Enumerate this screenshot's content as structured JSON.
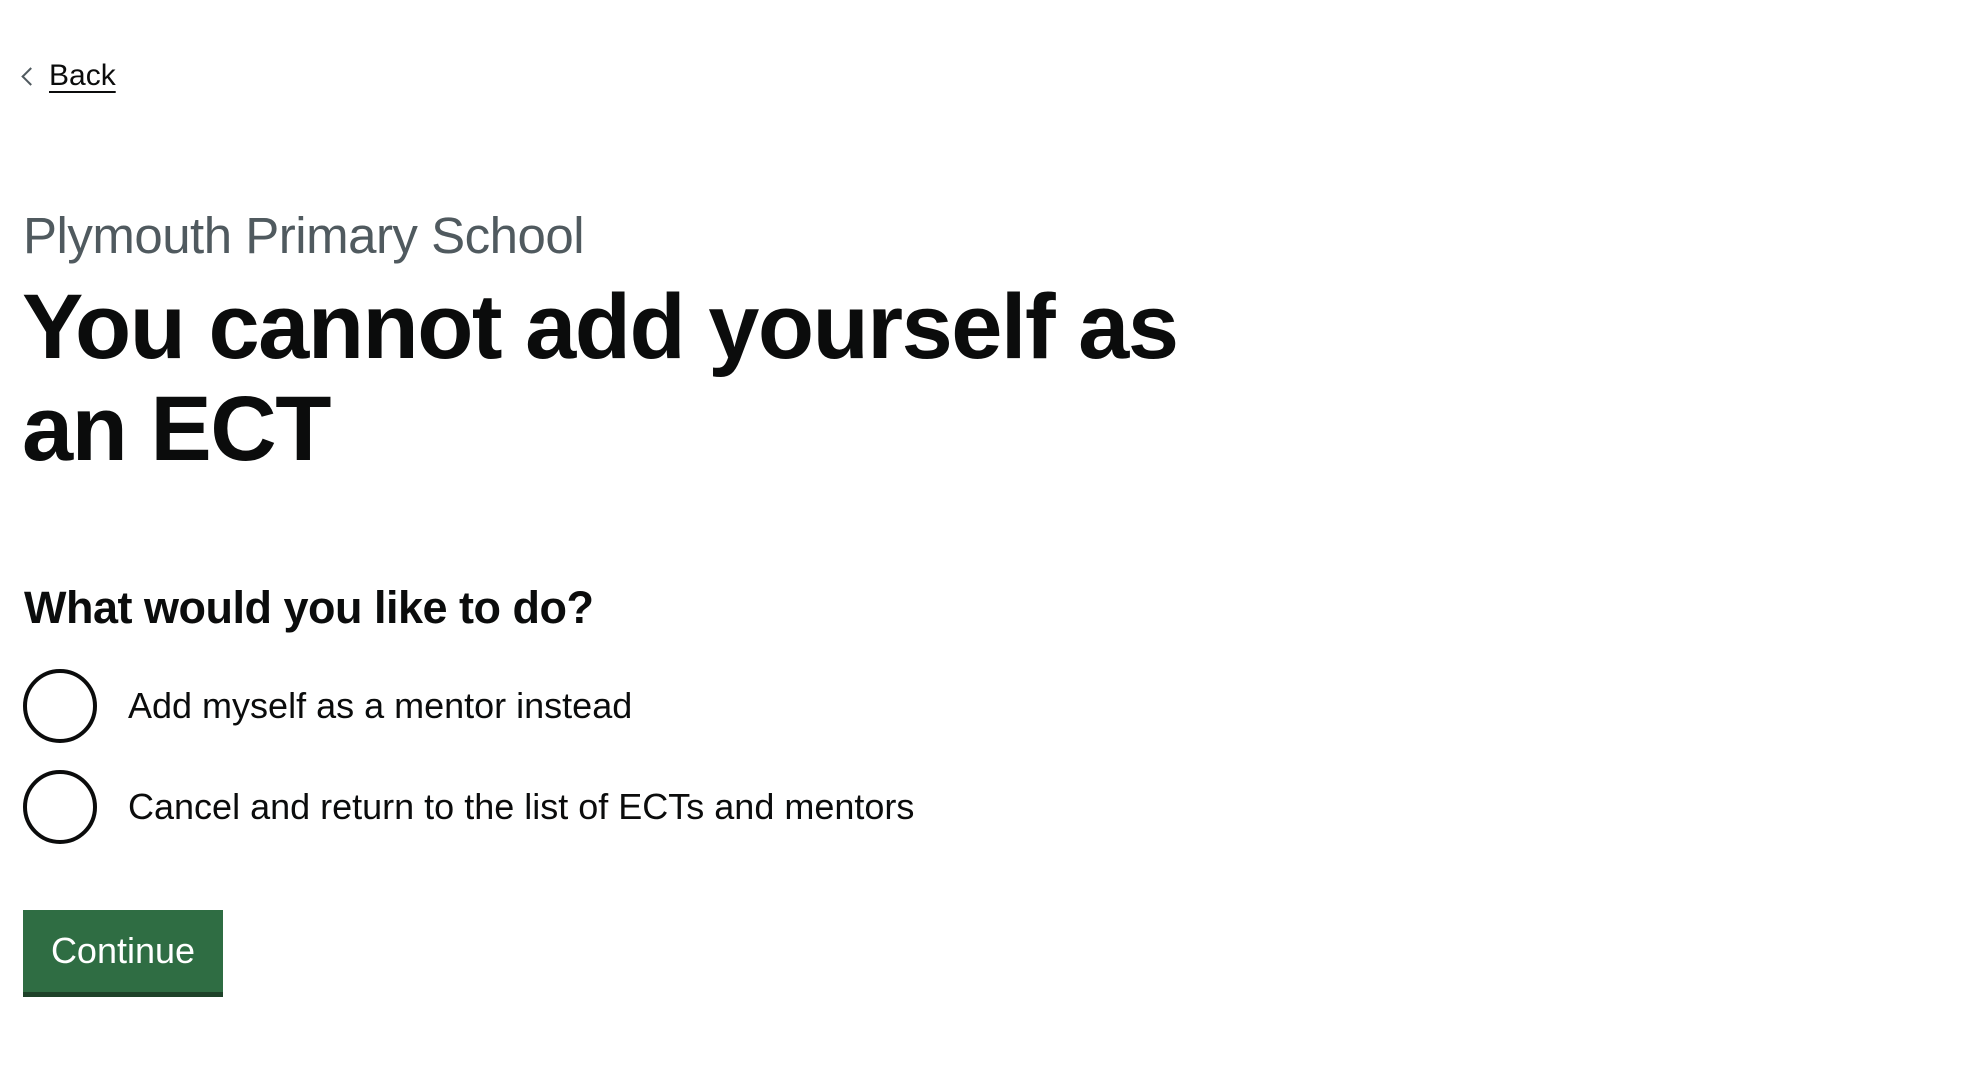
{
  "navigation": {
    "back_label": "Back"
  },
  "page": {
    "caption": "Plymouth Primary School",
    "heading": "You cannot add yourself as an ECT"
  },
  "form": {
    "legend": "What would you like to do?",
    "options": [
      {
        "label": "Add myself as a mentor instead"
      },
      {
        "label": "Cancel and return to the list of ECTs and mentors"
      }
    ],
    "submit_label": "Continue"
  },
  "colors": {
    "button": "#2f6d43",
    "caption": "#505a5f",
    "text": "#0b0c0c"
  }
}
